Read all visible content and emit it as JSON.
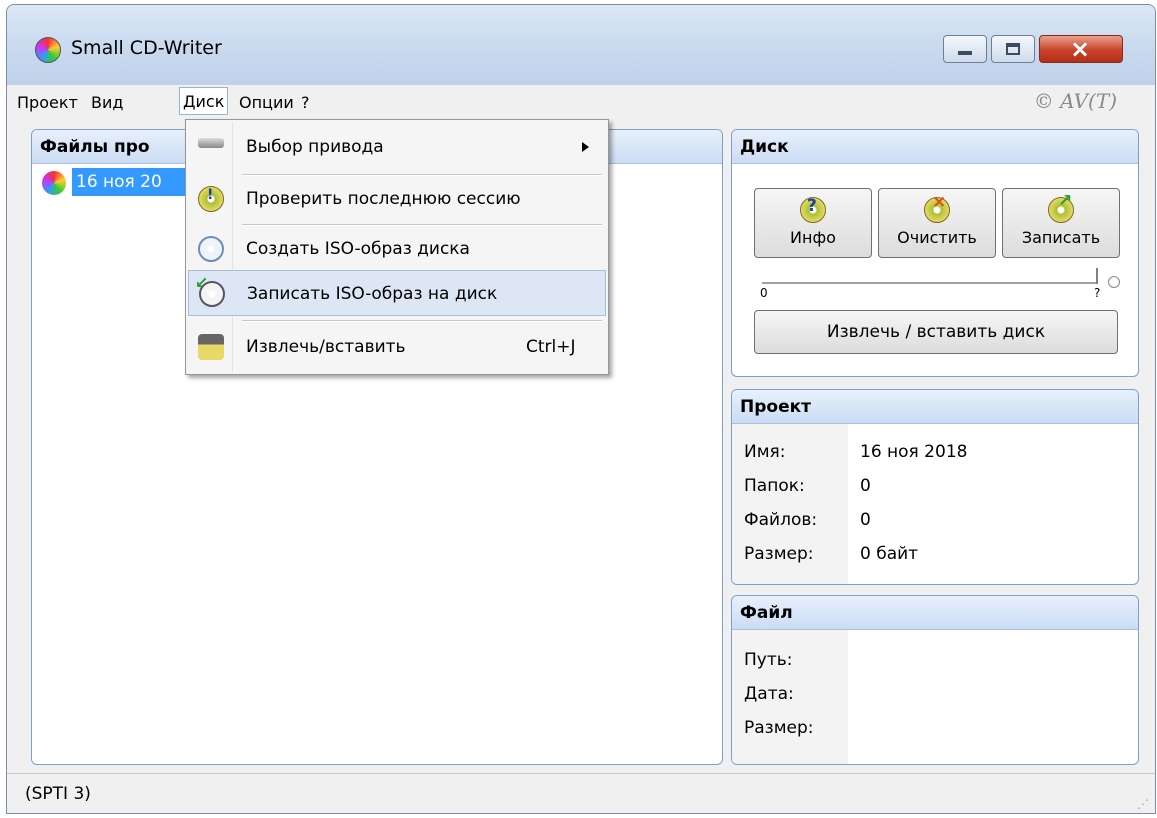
{
  "window": {
    "title": "Small CD-Writer"
  },
  "menubar": {
    "items": [
      "Проект",
      "Вид",
      "Диск",
      "Опции",
      "?"
    ],
    "copyright": "© AV(T)"
  },
  "files_panel": {
    "title": "Файлы про",
    "tree_item": "16 ноя 20"
  },
  "disk_panel": {
    "title": "Диск",
    "buttons": {
      "info": "Инфо",
      "clear": "Очистить",
      "write": "Записать"
    },
    "slider": {
      "min_label": "0",
      "max_label": "?",
      "value": 0
    },
    "eject_button": "Извлечь / вставить диск"
  },
  "project_panel": {
    "title": "Проект",
    "rows": [
      {
        "label": "Имя:",
        "value": "16 ноя 2018"
      },
      {
        "label": "Папок:",
        "value": "0"
      },
      {
        "label": "Файлов:",
        "value": "0"
      },
      {
        "label": "Размер:",
        "value": "0 байт"
      }
    ]
  },
  "file_panel": {
    "title": "Файл",
    "rows": [
      {
        "label": "Путь:"
      },
      {
        "label": "Дата:"
      },
      {
        "label": "Размер:"
      }
    ]
  },
  "statusbar": {
    "text": "(SPTI 3)"
  },
  "dropdown": {
    "items": [
      {
        "label": "Выбор привода"
      },
      {
        "label": "Проверить последнюю сессию"
      },
      {
        "label": "Создать ISO-образ диска"
      },
      {
        "label": "Записать ISO-образ на диск"
      },
      {
        "label": "Извлечь/вставить",
        "shortcut": "Ctrl+J"
      }
    ]
  },
  "colors": {
    "highlight": "#3399ff",
    "panel_border": "#7aa0cf",
    "close_button": "#c9432b"
  },
  "icons": {
    "app": "cd-icon",
    "info": "disc-question-icon",
    "clear": "disc-x-icon",
    "write": "disc-write-icon"
  }
}
